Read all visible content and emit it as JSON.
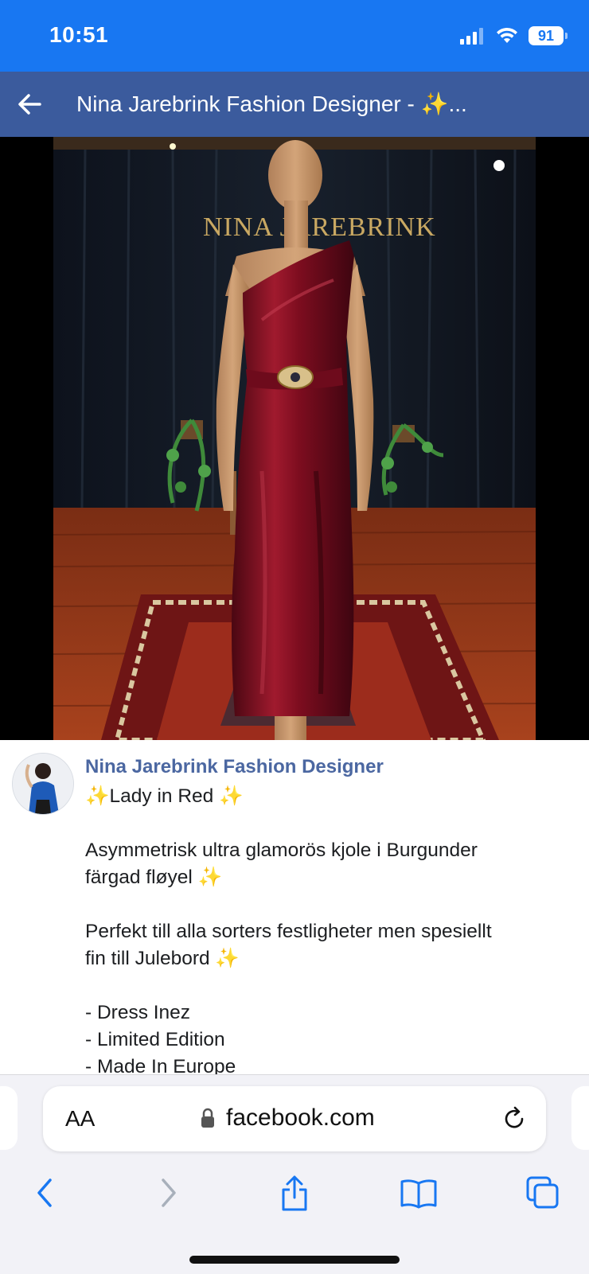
{
  "status_bar": {
    "time": "10:51",
    "battery": "91",
    "icons": [
      "cellular-signal-icon",
      "wifi-icon",
      "battery-icon"
    ]
  },
  "header": {
    "title": "Nina Jarebrink Fashion Designer - ✨...",
    "back_icon": "back-arrow-icon",
    "background": "#3b5b9d"
  },
  "photo": {
    "sign_text": "NINA JAREBRINK",
    "dress_color": "#8a0f22"
  },
  "post": {
    "author": "Nina Jarebrink Fashion Designer",
    "lines": [
      "✨Lady in Red ✨",
      "",
      "Asymmetrisk ultra glamorös kjole i Burgunder",
      "färgad fløyel ✨",
      "",
      "Perfekt till alla sorters festligheter men spesiellt",
      "fin till Julebord ✨",
      "",
      "- Dress Inez",
      "- Limited Edition",
      "- Made In Europe"
    ]
  },
  "browser": {
    "text_size_label": "AA",
    "domain": "facebook.com",
    "toolbar_icons": [
      "back-icon",
      "forward-icon",
      "share-icon",
      "bookmarks-icon",
      "tabs-icon"
    ],
    "accent": "#1877f2"
  }
}
